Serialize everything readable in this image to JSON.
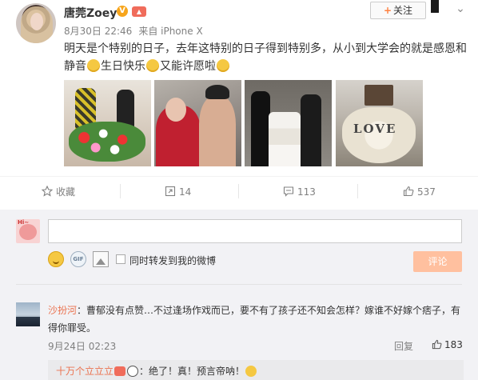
{
  "post": {
    "username": "唐莞Zoey",
    "vip_glyph": "V",
    "date": "8月30日 22:46",
    "source": "来自 iPhone X",
    "follow_label": "关注",
    "menu_glyph": "⌄",
    "text_part1": "明天是个特别的日子，去年这特别的日子得到特别多，从小到大学会的就是感恩和静音",
    "text_part2": "生日快乐",
    "text_part3": "又能许愿啦",
    "photo4_text": "LOVE"
  },
  "actions": {
    "favorite_label": "收藏",
    "repost_count": "14",
    "comment_count": "113",
    "like_count": "537"
  },
  "composer": {
    "avatar_text": "Hi~",
    "input_value": "",
    "gif_label": "GIF",
    "repost_label": "同时转发到我的微博",
    "submit_label": "评论"
  },
  "comment": {
    "author": "沙扮河",
    "text": "：曹郁没有点赞…不过逢场作戏而已，要不有了孩子还不知会怎样？嫁谁不好嫁个痞子，有得你罪受。",
    "time": "9月24日 02:23",
    "reply_label": "回复",
    "like_count": "183"
  },
  "sub_reply": {
    "author": "十万个立立立",
    "text": "：绝了！真！预言帝呐！"
  }
}
